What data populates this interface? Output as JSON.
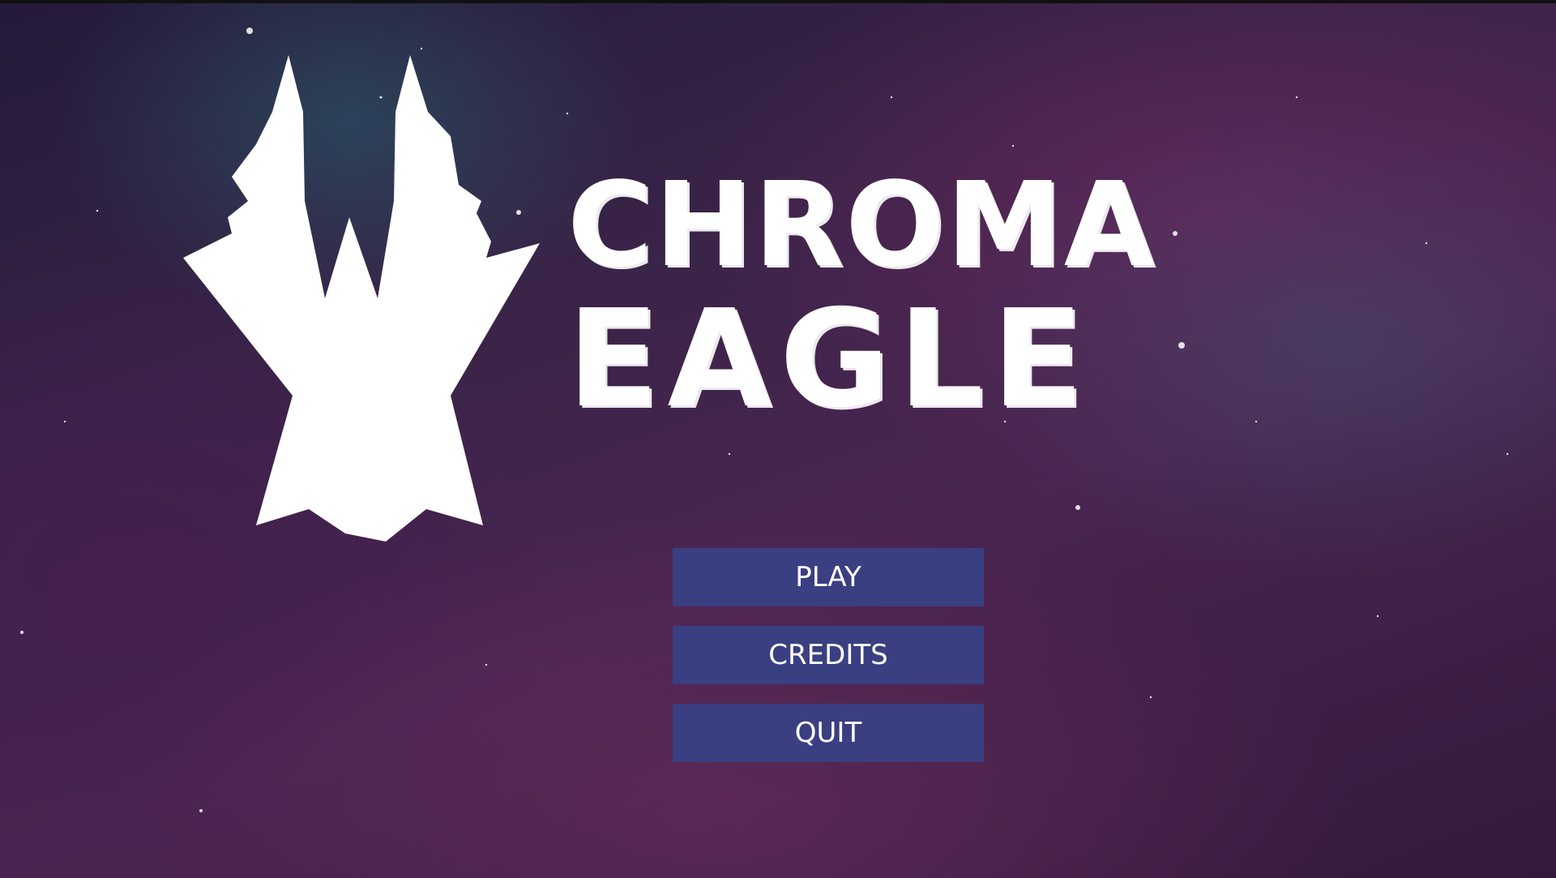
{
  "game": {
    "title_line_1": "CHROMA",
    "title_line_2": "EAGLE"
  },
  "menu": {
    "items": [
      {
        "id": "play",
        "label": "PLAY"
      },
      {
        "id": "credits",
        "label": "CREDITS"
      },
      {
        "id": "quit",
        "label": "QUIT"
      }
    ]
  },
  "colors": {
    "button_bg": "#3a3f82",
    "text": "#ffffff",
    "background_primary": "#3e2248",
    "nebula_teal": "#2d6e78"
  },
  "icons": {
    "logo": "eagle-logo-icon"
  }
}
